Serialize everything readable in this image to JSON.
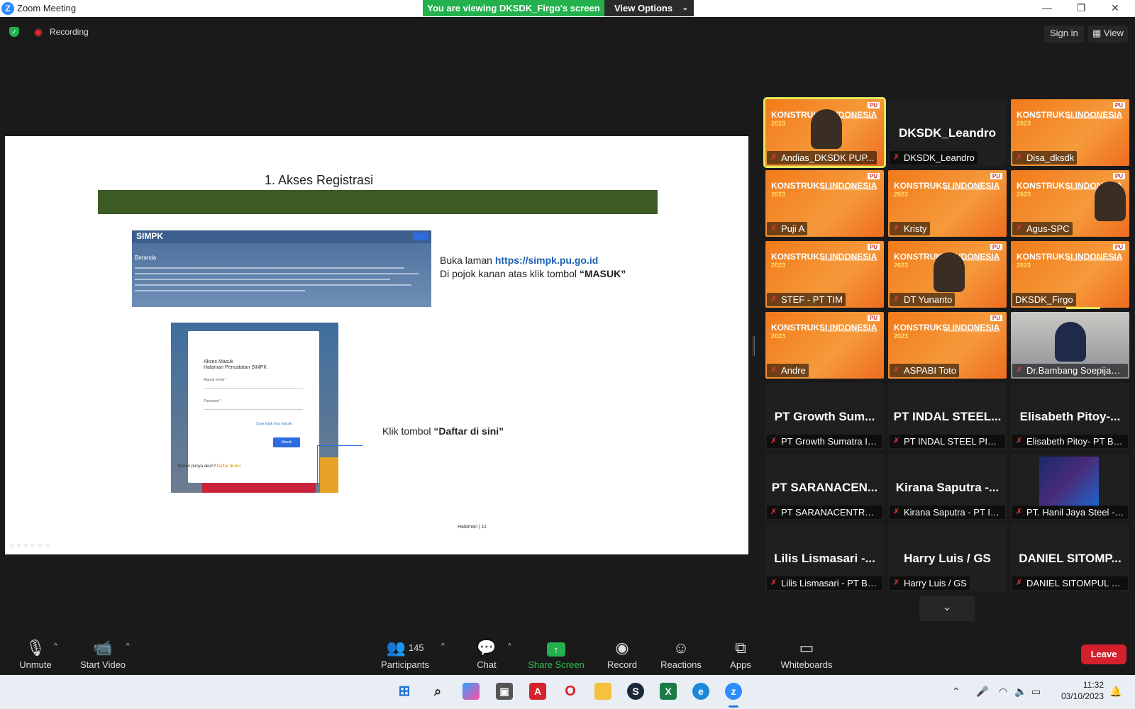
{
  "window": {
    "title": "Zoom Meeting",
    "logo_letter": "Z",
    "minimize": "—",
    "restore": "❐",
    "close": "✕"
  },
  "share_banner": {
    "viewing_text": "You are viewing DKSDK_Firgo's screen",
    "view_options_label": "View Options",
    "chevron": "⌄"
  },
  "status": {
    "recording_label": "Recording",
    "signin_label": "Sign in",
    "view_label": "View",
    "view_icon": "▦"
  },
  "slide": {
    "heading": "1. Akses Registrasi",
    "site_brand": "SIMPK",
    "site_beranda": "Beranda",
    "text1_prefix": "Buka laman ",
    "text1_url": "https://simpk.pu.go.id",
    "text2_prefix": "Di pojok kanan atas klik tombol ",
    "text2_bold": "“MASUK”",
    "login_title_1": "Akses Masuk",
    "login_title_2": "Halaman Pencatatan SIMPK",
    "login_email_label": "Alamat email *",
    "login_password_label": "Password *",
    "login_forgot": "Saya tidak bisa masuk",
    "login_button": "Masuk",
    "login_register_prefix": "Belum punya akun? ",
    "login_register_link": "Daftar di sini",
    "text3_prefix": "Klik tombol ",
    "text3_bold": "“Daftar di sini”",
    "page_label": "Halaman  |  11",
    "tools": "○○○○○○"
  },
  "gallery": {
    "banner_title": "KONSTRUKSI INDONESIA",
    "banner_year": "2023",
    "pu_badge": "PU",
    "banner_sub": "Direktorat Jenderal Bina Konstruksi",
    "mic_muted_icon": "✗",
    "tiles": [
      {
        "name": "Andias_DKSDK PUP...",
        "style": "orange-person",
        "active": true
      },
      {
        "name": "DKSDK_Leandro",
        "big": "DKSDK_Leandro",
        "style": "dark"
      },
      {
        "name": "Disa_dksdk",
        "style": "orange"
      },
      {
        "name": "Puji A",
        "style": "orange"
      },
      {
        "name": "Kristy",
        "style": "orange"
      },
      {
        "name": "Agus-SPC",
        "style": "orange-person"
      },
      {
        "name": "STEF - PT TIM",
        "style": "orange"
      },
      {
        "name": "DT Yunanto",
        "style": "orange-person"
      },
      {
        "name": "DKSDK_Firgo",
        "style": "orange",
        "nomic": true
      },
      {
        "name": "Andre",
        "style": "orange"
      },
      {
        "name": "ASPABI Toto",
        "style": "orange"
      },
      {
        "name": "Dr.Bambang Soepijant...",
        "style": "photo"
      },
      {
        "name": "PT Growth Sumatra In...",
        "big": "PT Growth Sum...",
        "style": "dark"
      },
      {
        "name": "PT INDAL STEEL PIPE - ...",
        "big": "PT INDAL STEEL...",
        "style": "dark"
      },
      {
        "name": "Elisabeth Pitoy- PT Bak...",
        "big": "Elisabeth Pitoy-...",
        "style": "dark"
      },
      {
        "name": "PT SARANACENTRAL ...",
        "big": "PT SARANACEN...",
        "style": "dark"
      },
      {
        "name": "Kirana Saputra - PT Ind...",
        "big": "Kirana Saputra -...",
        "style": "dark"
      },
      {
        "name": "PT. Hanil Jaya Steel - S...",
        "style": "cam"
      },
      {
        "name": "Lilis Lismasari - PT BEV...",
        "big": "Lilis Lismasari -...",
        "style": "dark"
      },
      {
        "name": "Harry Luis / GS",
        "big": "Harry Luis / GS",
        "style": "dark"
      },
      {
        "name": "DANIEL SITOMPUL PT ...",
        "big": "DANIEL SITOMP...",
        "style": "dark"
      }
    ],
    "scroll_icon": "⌄"
  },
  "toolbar": {
    "unmute": "Unmute",
    "start_video": "Start Video",
    "participants": "Participants",
    "participants_count": "145",
    "chat": "Chat",
    "share_screen": "Share Screen",
    "record": "Record",
    "reactions": "Reactions",
    "apps": "Apps",
    "whiteboards": "Whiteboards",
    "leave": "Leave",
    "caret": "^"
  },
  "taskbar": {
    "time": "11:32",
    "date": "03/10/2023"
  }
}
